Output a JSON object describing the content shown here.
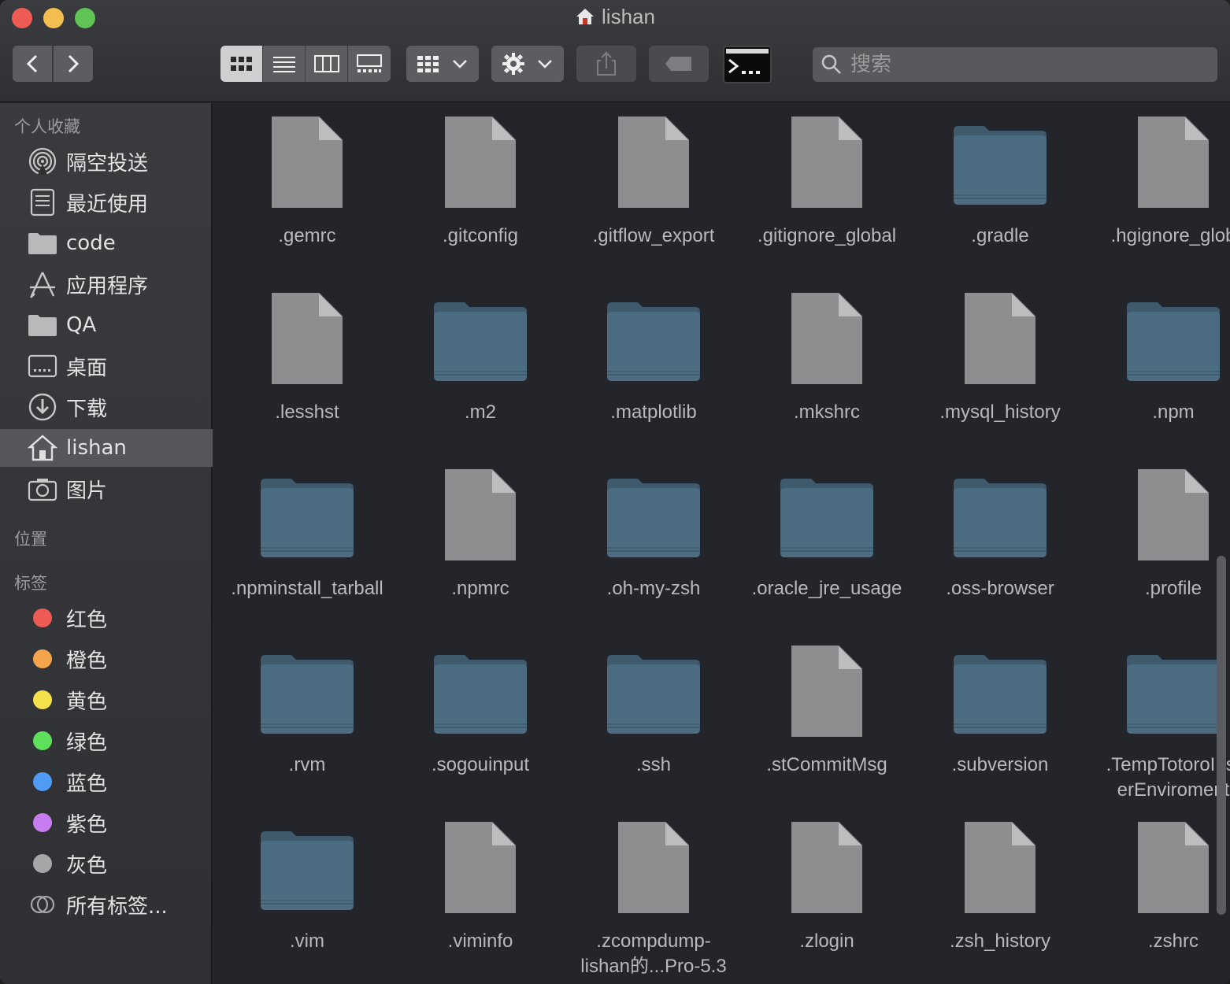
{
  "window": {
    "title": "lishan"
  },
  "toolbar": {
    "search_placeholder": "搜索"
  },
  "sidebar": {
    "favorites_header": "个人收藏",
    "favorites": [
      {
        "label": "隔空投送",
        "icon": "airdrop-icon"
      },
      {
        "label": "最近使用",
        "icon": "recents-icon"
      },
      {
        "label": "code",
        "icon": "folder-icon"
      },
      {
        "label": "应用程序",
        "icon": "applications-icon"
      },
      {
        "label": "QA",
        "icon": "folder-icon"
      },
      {
        "label": "桌面",
        "icon": "desktop-icon"
      },
      {
        "label": "下载",
        "icon": "downloads-icon"
      },
      {
        "label": "lishan",
        "icon": "home-icon",
        "active": true
      },
      {
        "label": "图片",
        "icon": "camera-icon"
      }
    ],
    "locations_header": "位置",
    "tags_header": "标签",
    "tags": [
      {
        "label": "红色",
        "color": "#ee5b54"
      },
      {
        "label": "橙色",
        "color": "#f4a44a"
      },
      {
        "label": "黄色",
        "color": "#f6e04c"
      },
      {
        "label": "绿色",
        "color": "#5ee05a"
      },
      {
        "label": "蓝色",
        "color": "#4f9bf5"
      },
      {
        "label": "紫色",
        "color": "#c77df0"
      },
      {
        "label": "灰色",
        "color": "#a6a6a8"
      },
      {
        "label": "所有标签...",
        "color": ""
      }
    ]
  },
  "files": [
    {
      "name": ".gemrc",
      "type": "file"
    },
    {
      "name": ".gitconfig",
      "type": "file"
    },
    {
      "name": ".gitflow_export",
      "type": "file"
    },
    {
      "name": ".gitignore_global",
      "type": "file"
    },
    {
      "name": ".gradle",
      "type": "folder"
    },
    {
      "name": ".hgignore_glob",
      "type": "file"
    },
    {
      "name": ".lesshst",
      "type": "file"
    },
    {
      "name": ".m2",
      "type": "folder"
    },
    {
      "name": ".matplotlib",
      "type": "folder"
    },
    {
      "name": ".mkshrc",
      "type": "file"
    },
    {
      "name": ".mysql_history",
      "type": "file"
    },
    {
      "name": ".npm",
      "type": "folder"
    },
    {
      "name": ".npminstall_tarball",
      "type": "folder"
    },
    {
      "name": ".npmrc",
      "type": "file"
    },
    {
      "name": ".oh-my-zsh",
      "type": "folder"
    },
    {
      "name": ".oracle_jre_usage",
      "type": "folder"
    },
    {
      "name": ".oss-browser",
      "type": "folder"
    },
    {
      "name": ".profile",
      "type": "file"
    },
    {
      "name": ".rvm",
      "type": "folder"
    },
    {
      "name": ".sogouinput",
      "type": "folder"
    },
    {
      "name": ".ssh",
      "type": "folder"
    },
    {
      "name": ".stCommitMsg",
      "type": "file"
    },
    {
      "name": ".subversion",
      "type": "folder"
    },
    {
      "name": ".TempTotoroInst\nerEnviroment",
      "type": "folder"
    },
    {
      "name": ".vim",
      "type": "folder"
    },
    {
      "name": ".viminfo",
      "type": "file"
    },
    {
      "name": ".zcompdump-\nlishan的...Pro-5.3",
      "type": "file"
    },
    {
      "name": ".zlogin",
      "type": "file"
    },
    {
      "name": ".zsh_history",
      "type": "file"
    },
    {
      "name": ".zshrc",
      "type": "file"
    }
  ]
}
